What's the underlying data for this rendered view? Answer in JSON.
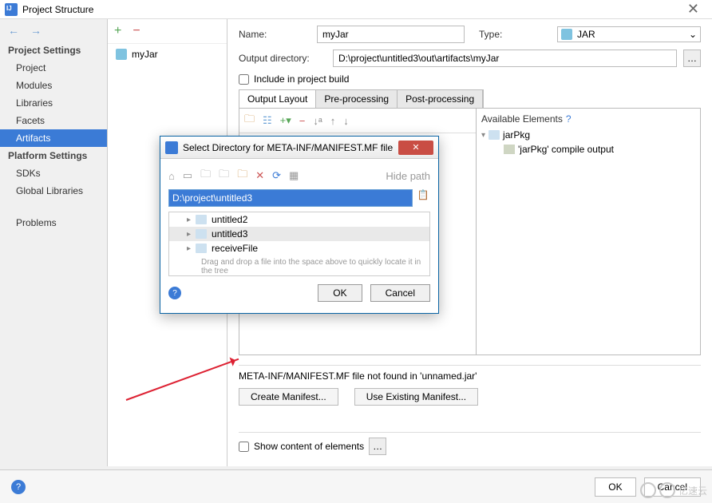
{
  "window_title": "Project Structure",
  "sidebar": {
    "heading1": "Project Settings",
    "items1": [
      "Project",
      "Modules",
      "Libraries",
      "Facets",
      "Artifacts"
    ],
    "selected1": "Artifacts",
    "heading2": "Platform Settings",
    "items2": [
      "SDKs",
      "Global Libraries"
    ],
    "problems": "Problems"
  },
  "artifact_list": {
    "items": [
      "myJar"
    ]
  },
  "form": {
    "name_label": "Name:",
    "name_value": "myJar",
    "type_label": "Type:",
    "type_value": "JAR",
    "outdir_label": "Output directory:",
    "outdir_value": "D:\\project\\untitled3\\out\\artifacts\\myJar",
    "include_build": "Include in project build",
    "tabs": [
      "Output Layout",
      "Pre-processing",
      "Post-processing"
    ],
    "active_tab": "Output Layout",
    "available_title": "Available Elements",
    "avail_tree": {
      "root": "jarPkg",
      "child": "'jarPkg' compile output"
    },
    "warning": "META-INF/MANIFEST.MF file not found in 'unnamed.jar'",
    "create_btn": "Create Manifest...",
    "use_btn": "Use Existing Manifest...",
    "show_content": "Show content of elements"
  },
  "dialog": {
    "title": "Select Directory for META-INF/MANIFEST.MF file",
    "hide_path": "Hide path",
    "path_value": "D:\\project\\untitled3",
    "tree": [
      "untitled2",
      "untitled3",
      "receiveFile"
    ],
    "selected": "untitled3",
    "hint": "Drag and drop a file into the space above to quickly locate it in the tree",
    "ok": "OK",
    "cancel": "Cancel"
  },
  "footer": {
    "ok": "OK",
    "cancel": "Cancel"
  },
  "watermark": "亿速云"
}
